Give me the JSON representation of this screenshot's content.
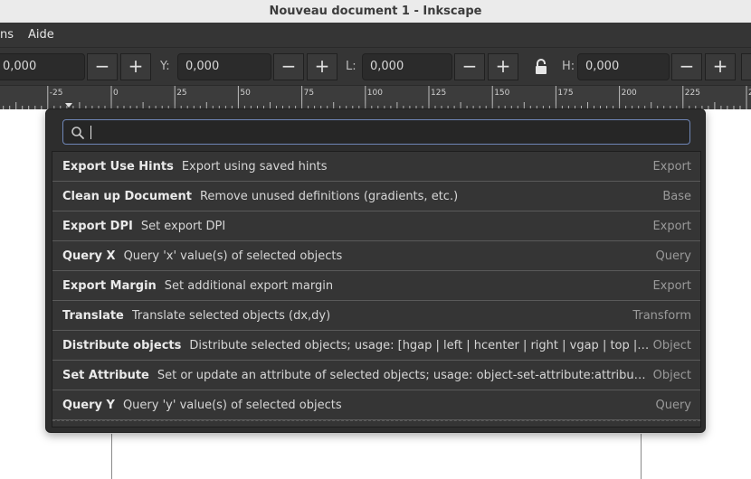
{
  "window": {
    "title": "Nouveau document 1 - Inkscape"
  },
  "menubar": {
    "items": [
      "ns",
      "Aide"
    ]
  },
  "toolbar": {
    "x_value": "0,000",
    "y_label": "Y:",
    "y_value": "0,000",
    "w_label": "L:",
    "w_value": "0,000",
    "h_label": "H:",
    "h_value": "0,000",
    "minus": "−",
    "plus": "+"
  },
  "ruler": {
    "ticks": [
      "-25",
      "0",
      "25",
      "50",
      "75",
      "100",
      "125",
      "150",
      "175",
      "200",
      "225",
      "25"
    ]
  },
  "command_palette": {
    "search_value": "",
    "commands": [
      {
        "name": "Export Use Hints",
        "desc": "Export using saved hints",
        "category": "Export"
      },
      {
        "name": "Clean up Document",
        "desc": "Remove unused definitions (gradients, etc.)",
        "category": "Base"
      },
      {
        "name": "Export DPI",
        "desc": "Set export DPI",
        "category": "Export"
      },
      {
        "name": "Query X",
        "desc": "Query 'x' value(s) of selected objects",
        "category": "Query"
      },
      {
        "name": "Export Margin",
        "desc": "Set additional export margin",
        "category": "Export"
      },
      {
        "name": "Translate",
        "desc": "Translate selected objects (dx,dy)",
        "category": "Transform"
      },
      {
        "name": "Distribute objects",
        "desc": "Distribute selected objects; usage: [hgap | left | hcenter | right | vgap | top | vcenter | b...",
        "category": "Object"
      },
      {
        "name": "Set Attribute",
        "desc": "Set or update an attribute of selected objects; usage: object-set-attribute:attribute name, at...",
        "category": "Object"
      },
      {
        "name": "Query Y",
        "desc": "Query 'y' value(s) of selected objects",
        "category": "Query"
      }
    ]
  }
}
